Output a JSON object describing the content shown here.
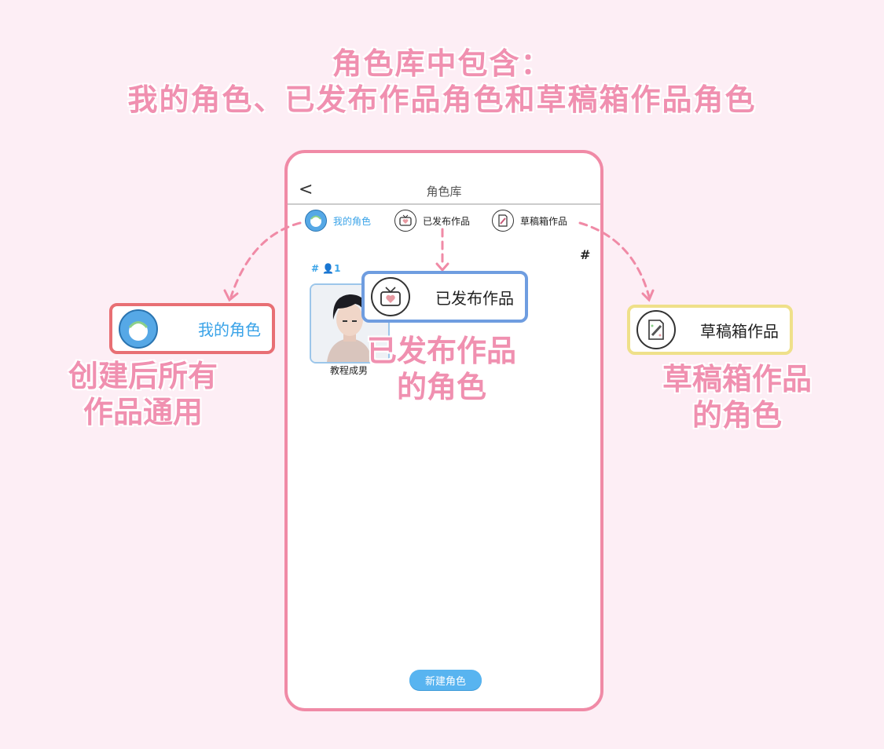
{
  "headline": {
    "line1": "角色库中包含：",
    "line2": "我的角色、已发布作品角色和草稿箱作品角色"
  },
  "phone": {
    "back_label": "<",
    "title": "角色库",
    "tabs": [
      {
        "label": "我的角色",
        "icon": "avatar-icon",
        "active": true
      },
      {
        "label": "已发布作品",
        "icon": "tv-heart-icon",
        "active": false
      },
      {
        "label": "草稿箱作品",
        "icon": "paper-pencil-icon",
        "active": false
      }
    ],
    "hash_right": "#",
    "count_label": "# 👤1",
    "card_label": "教程成男",
    "new_button": "新建角色"
  },
  "callouts": {
    "mine": "我的角色",
    "published": "已发布作品",
    "drafts": "草稿箱作品"
  },
  "notes": {
    "mine_line1": "创建后所有",
    "mine_line2": "作品通用",
    "pub_line1": "已发布作品",
    "pub_line2": "的角色",
    "draft_line1": "草稿箱作品",
    "draft_line2": "的角色"
  },
  "colors": {
    "accent_pink": "#f090b0",
    "accent_blue": "#3aa3e8",
    "phone_border": "#f08aa6",
    "mine_border": "#e86f74",
    "pub_border": "#6f9de0",
    "draft_border": "#efe08a"
  }
}
